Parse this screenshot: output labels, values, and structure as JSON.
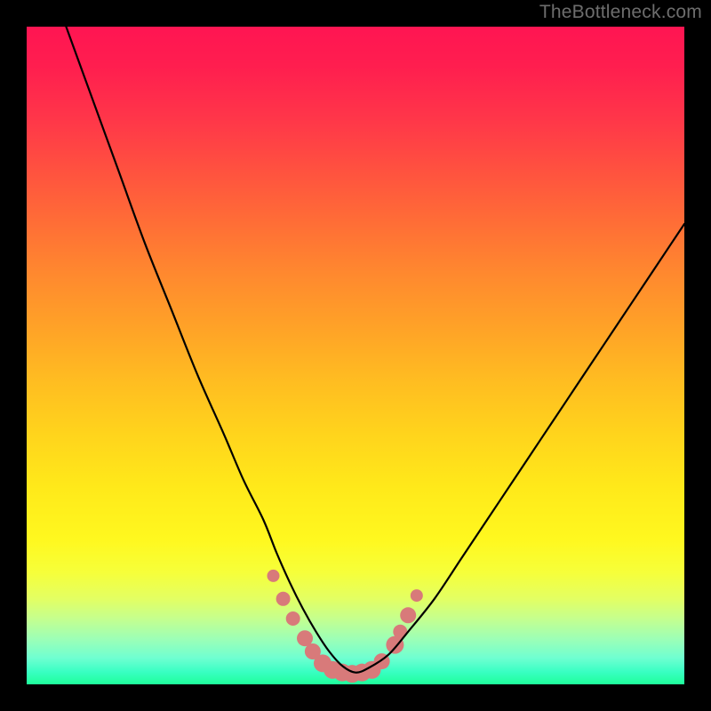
{
  "watermark": "TheBottleneck.com",
  "chart_data": {
    "type": "line",
    "title": "",
    "xlabel": "",
    "ylabel": "",
    "xlim": [
      0,
      100
    ],
    "ylim": [
      0,
      100
    ],
    "gradient_stops": [
      {
        "pct": 0,
        "color": "#ff1552"
      },
      {
        "pct": 6,
        "color": "#ff1e4f"
      },
      {
        "pct": 14,
        "color": "#ff3649"
      },
      {
        "pct": 22,
        "color": "#ff523f"
      },
      {
        "pct": 30,
        "color": "#ff6e36"
      },
      {
        "pct": 38,
        "color": "#ff8a2e"
      },
      {
        "pct": 46,
        "color": "#ffa327"
      },
      {
        "pct": 54,
        "color": "#ffbd21"
      },
      {
        "pct": 62,
        "color": "#ffd41c"
      },
      {
        "pct": 70,
        "color": "#ffe91a"
      },
      {
        "pct": 78,
        "color": "#fff81f"
      },
      {
        "pct": 83,
        "color": "#f6ff3a"
      },
      {
        "pct": 87,
        "color": "#e3ff63"
      },
      {
        "pct": 90,
        "color": "#c5ff8e"
      },
      {
        "pct": 93,
        "color": "#9effb5"
      },
      {
        "pct": 96,
        "color": "#6fffd1"
      },
      {
        "pct": 98,
        "color": "#3bffc4"
      },
      {
        "pct": 100,
        "color": "#1eff9a"
      }
    ],
    "series": [
      {
        "name": "bottleneck-curve",
        "stroke": "#000000",
        "stroke_width": 2.2,
        "x": [
          6.0,
          10,
          14,
          18,
          22,
          26,
          30,
          33,
          36,
          38,
          40,
          42,
          44,
          46,
          48,
          50,
          52,
          55,
          58,
          62,
          66,
          70,
          74,
          78,
          82,
          86,
          90,
          94,
          98,
          100
        ],
        "y": [
          100,
          89,
          78,
          67,
          57,
          47,
          38,
          31,
          25,
          20,
          15.5,
          11.5,
          8,
          5,
          2.8,
          1.8,
          2.5,
          4.5,
          8,
          13,
          19,
          25,
          31,
          37,
          43,
          49,
          55,
          61,
          67,
          70
        ]
      }
    ],
    "markers": {
      "color": "#d87a7a",
      "points_xy": [
        [
          37.5,
          16.5
        ],
        [
          39.0,
          13.0
        ],
        [
          40.5,
          10.0
        ],
        [
          42.3,
          7.0
        ],
        [
          43.5,
          5.0
        ],
        [
          45.0,
          3.2
        ],
        [
          46.5,
          2.2
        ],
        [
          48.0,
          1.8
        ],
        [
          49.5,
          1.6
        ],
        [
          51.0,
          1.8
        ],
        [
          52.5,
          2.2
        ],
        [
          54.0,
          3.5
        ],
        [
          56.0,
          6.0
        ],
        [
          56.8,
          8.0
        ],
        [
          58.0,
          10.5
        ],
        [
          59.3,
          13.5
        ]
      ],
      "radii": [
        7,
        8,
        8,
        9,
        9,
        10,
        10,
        10,
        10,
        10,
        10,
        9,
        10,
        8,
        9,
        7
      ]
    }
  }
}
